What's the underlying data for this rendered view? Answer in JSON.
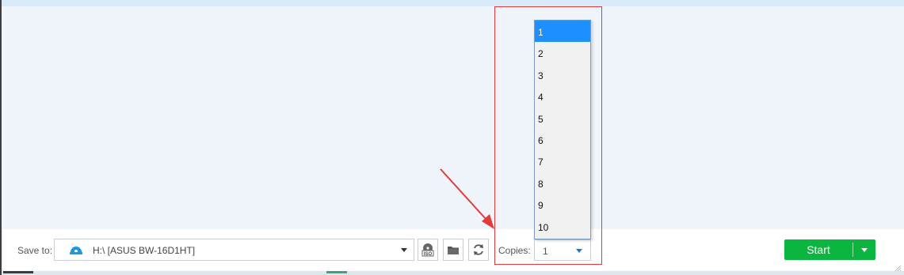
{
  "save_bar": {
    "label": "Save to:",
    "drive": "H:\\ [ASUS BW-16D1HT]"
  },
  "toolbar": {
    "iso_icon_text": "ISO"
  },
  "copies": {
    "label": "Copies:",
    "value": "1",
    "options": [
      "1",
      "2",
      "3",
      "4",
      "5",
      "6",
      "7",
      "8",
      "9",
      "10"
    ],
    "selected_index": 0
  },
  "start": {
    "label": "Start"
  },
  "colors": {
    "accent_green": "#0bb53f",
    "selected_blue": "#1e8fff",
    "highlight_red": "#e23b3b"
  },
  "icons": [
    "disc-drive-icon",
    "iso-icon",
    "folder-icon",
    "refresh-icon",
    "chevron-down-icon",
    "arrow-icon",
    "resize-grip-icon"
  ]
}
